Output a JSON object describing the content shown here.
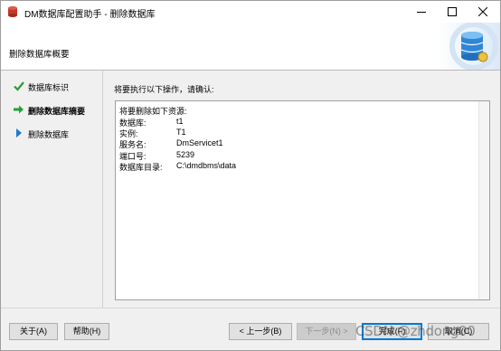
{
  "window": {
    "title": "DM数据库配置助手 - 删除数据库",
    "controls": {
      "minimize": "minimize",
      "maximize": "maximize",
      "close": "close"
    }
  },
  "header": {
    "title": "删除数据库概要",
    "image": "database-settings-icon"
  },
  "nav": {
    "items": [
      {
        "label": "数据库标识",
        "icon": "check-icon",
        "state": "done"
      },
      {
        "label": "删除数据库摘要",
        "icon": "arrow-right-icon",
        "state": "current"
      },
      {
        "label": "删除数据库",
        "icon": "triangle-right-icon",
        "state": "pending"
      }
    ]
  },
  "main": {
    "prompt": "将要执行以下操作，请确认:",
    "summary": {
      "heading": "将要删除如下资源:",
      "rows": [
        {
          "key": "数据库:",
          "value": "t1"
        },
        {
          "key": "实例:",
          "value": "T1"
        },
        {
          "key": "服务名:",
          "value": "DmServicet1"
        },
        {
          "key": "端口号:",
          "value": "5239"
        },
        {
          "key": "数据库目录:",
          "value": "C:\\dmdbms\\data"
        }
      ]
    }
  },
  "footer": {
    "about": "关于(A)",
    "help": "帮助(H)",
    "prev": "< 上一步(B)",
    "next": "下一步(N) >",
    "finish": "完成(F)",
    "cancel": "取消(C)"
  },
  "watermark": "CSDN @zhdong00",
  "colors": {
    "check": "#2e9a2e",
    "arrow": "#21a336",
    "triangle": "#1e78d2",
    "default_button_border": "#0078d7"
  }
}
